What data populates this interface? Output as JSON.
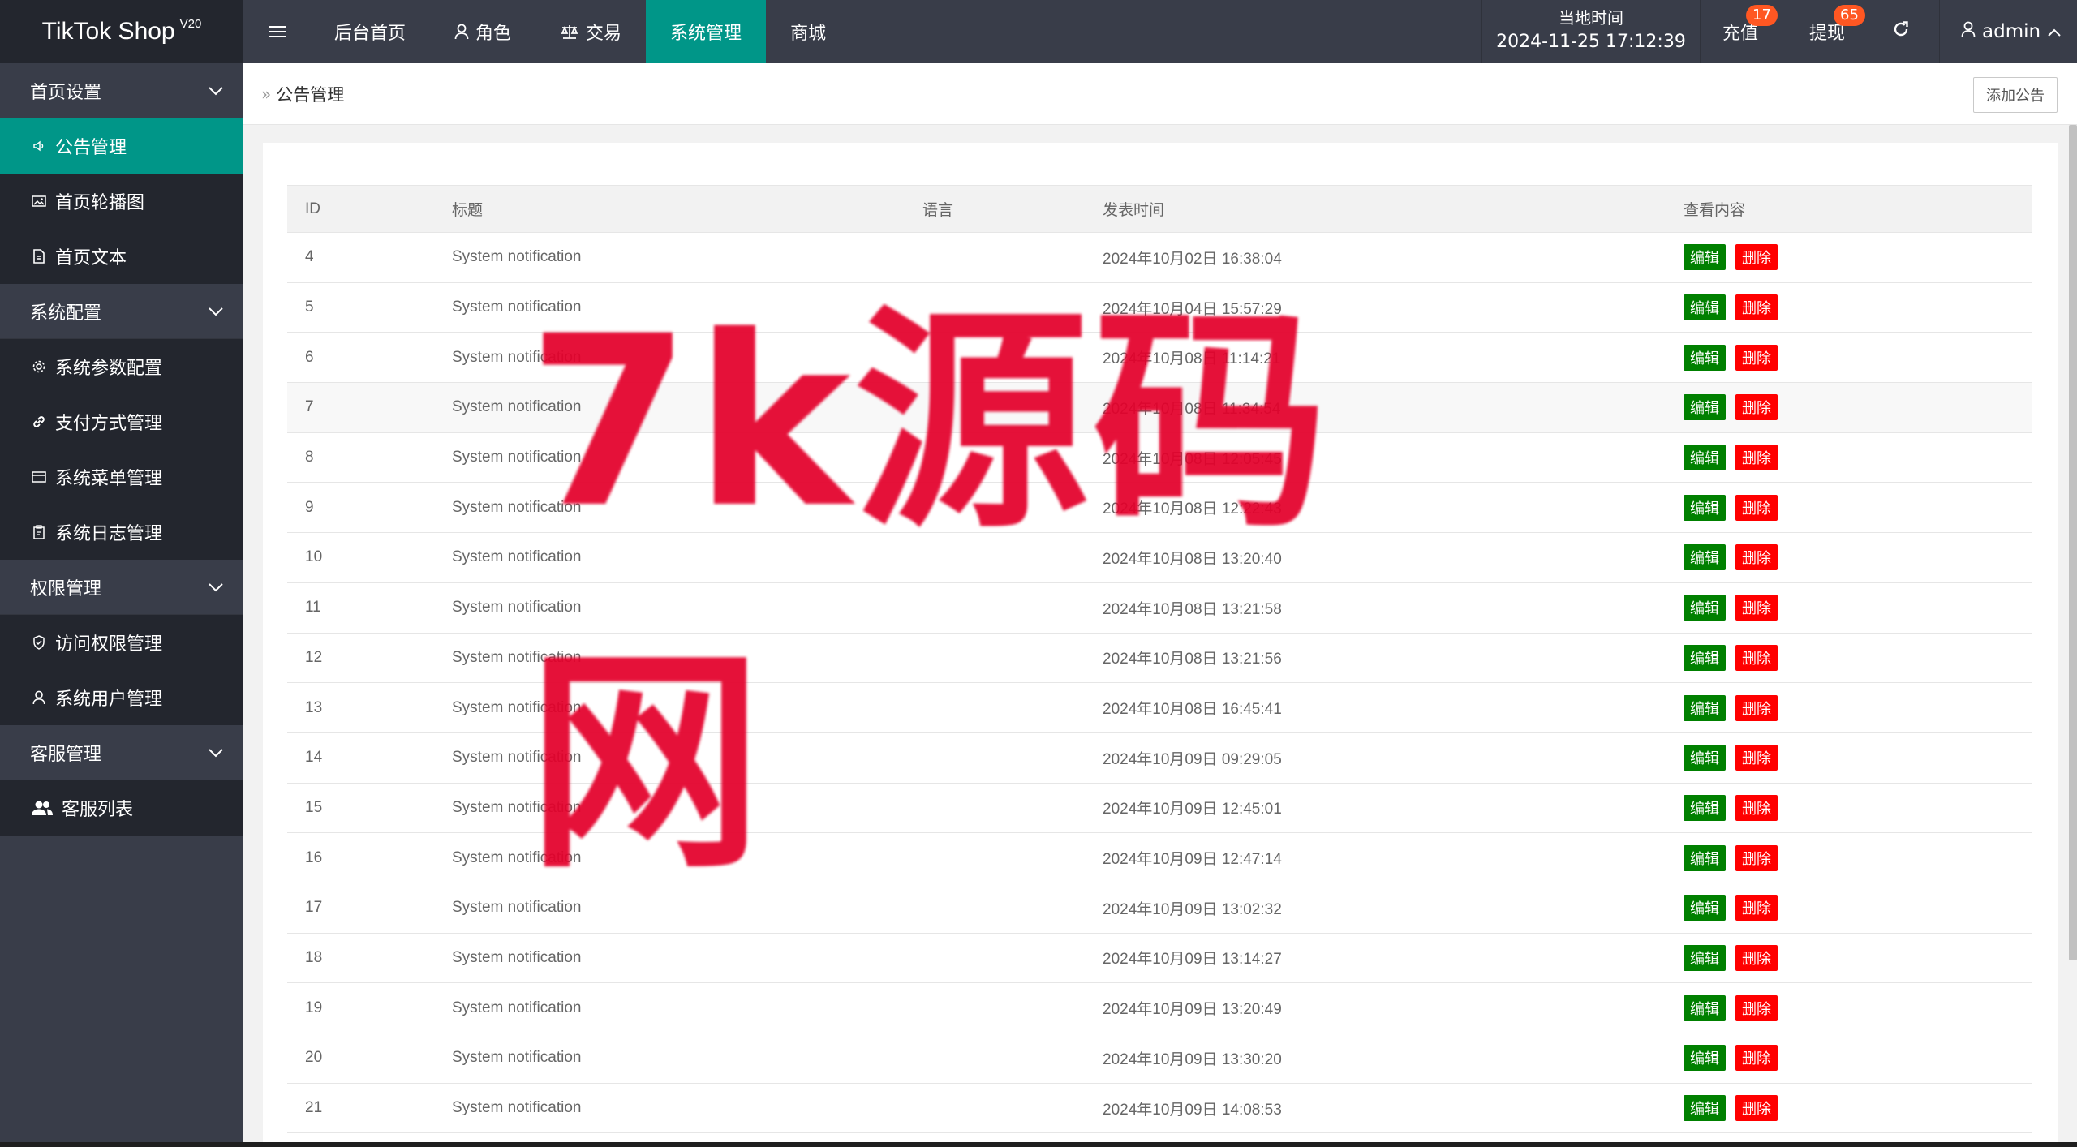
{
  "header": {
    "logo": "TikTok Shop",
    "version": "V20",
    "nav": [
      "后台首页",
      "角色",
      "交易",
      "系统管理",
      "商城"
    ],
    "active_nav": 3,
    "time_label": "当地时间",
    "time_value": "2024-11-25 17:12:39",
    "recharge": "充值",
    "recharge_badge": "17",
    "withdraw": "提现",
    "withdraw_badge": "65",
    "user": "admin"
  },
  "sidebar": {
    "groups": [
      {
        "label": "首页设置",
        "items": [
          "公告管理",
          "首页轮播图",
          "首页文本"
        ]
      },
      {
        "label": "系统配置",
        "items": [
          "系统参数配置",
          "支付方式管理",
          "系统菜单管理",
          "系统日志管理"
        ]
      },
      {
        "label": "权限管理",
        "items": [
          "访问权限管理",
          "系统用户管理"
        ]
      },
      {
        "label": "客服管理",
        "items": [
          "客服列表"
        ]
      }
    ]
  },
  "breadcrumb": {
    "current": "公告管理"
  },
  "toolbar": {
    "add_label": "添加公告"
  },
  "table": {
    "columns": [
      "ID",
      "标题",
      "语言",
      "发表时间",
      "查看内容"
    ],
    "edit_label": "编辑",
    "delete_label": "删除",
    "rows": [
      {
        "id": "4",
        "title": "System notification",
        "lang": "",
        "time": "2024年10月02日 16:38:04"
      },
      {
        "id": "5",
        "title": "System notification",
        "lang": "",
        "time": "2024年10月04日 15:57:29"
      },
      {
        "id": "6",
        "title": "System notification",
        "lang": "",
        "time": "2024年10月08日 11:14:21"
      },
      {
        "id": "7",
        "title": "System notification",
        "lang": "",
        "time": "2024年10月08日 11:34:54"
      },
      {
        "id": "8",
        "title": "System notification",
        "lang": "",
        "time": "2024年10月08日 12:05:45"
      },
      {
        "id": "9",
        "title": "System notification",
        "lang": "",
        "time": "2024年10月08日 12:22:43"
      },
      {
        "id": "10",
        "title": "System notification",
        "lang": "",
        "time": "2024年10月08日 13:20:40"
      },
      {
        "id": "11",
        "title": "System notification",
        "lang": "",
        "time": "2024年10月08日 13:21:58"
      },
      {
        "id": "12",
        "title": "System notification",
        "lang": "",
        "time": "2024年10月08日 13:21:56"
      },
      {
        "id": "13",
        "title": "System notification",
        "lang": "",
        "time": "2024年10月08日 16:45:41"
      },
      {
        "id": "14",
        "title": "System notification",
        "lang": "",
        "time": "2024年10月09日 09:29:05"
      },
      {
        "id": "15",
        "title": "System notification",
        "lang": "",
        "time": "2024年10月09日 12:45:01"
      },
      {
        "id": "16",
        "title": "System notification",
        "lang": "",
        "time": "2024年10月09日 12:47:14"
      },
      {
        "id": "17",
        "title": "System notification",
        "lang": "",
        "time": "2024年10月09日 13:02:32"
      },
      {
        "id": "18",
        "title": "System notification",
        "lang": "",
        "time": "2024年10月09日 13:14:27"
      },
      {
        "id": "19",
        "title": "System notification",
        "lang": "",
        "time": "2024年10月09日 13:20:49"
      },
      {
        "id": "20",
        "title": "System notification",
        "lang": "",
        "time": "2024年10月09日 13:30:20"
      },
      {
        "id": "21",
        "title": "System notification",
        "lang": "",
        "time": "2024年10月09日 14:08:53"
      }
    ]
  },
  "watermark": "7k源码网",
  "colors": {
    "accent": "#009688",
    "sidebar": "#393d49",
    "edit": "#008000",
    "delete": "#ff0000",
    "badge": "#ff5722"
  }
}
